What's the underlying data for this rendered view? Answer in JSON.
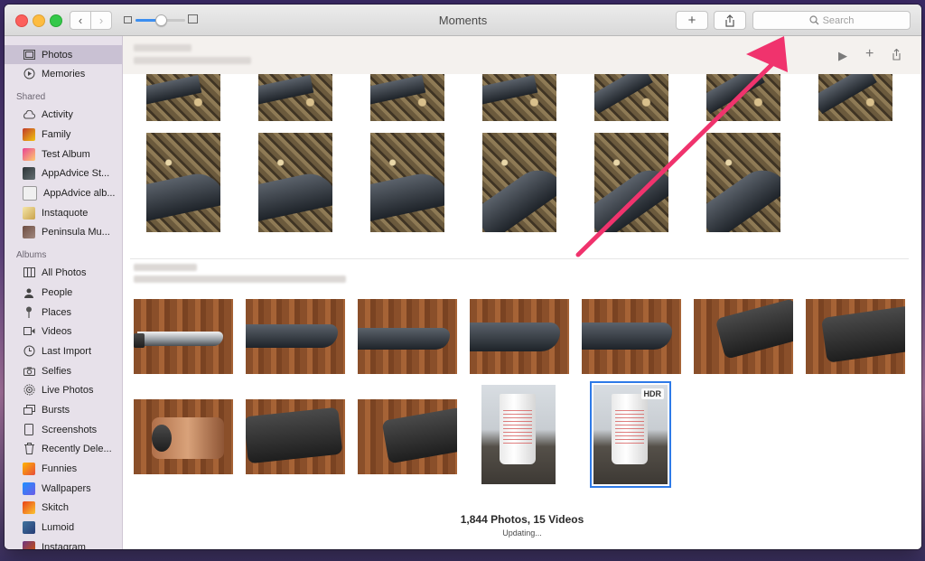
{
  "window": {
    "title": "Moments"
  },
  "search": {
    "placeholder": "Search"
  },
  "sidebar": {
    "top_items": [
      {
        "label": "Photos",
        "icon": "photos-icon"
      },
      {
        "label": "Memories",
        "icon": "memories-icon"
      }
    ],
    "shared_heading": "Shared",
    "shared_items": [
      {
        "label": "Activity",
        "icon": "activity-cloud-icon"
      },
      {
        "label": "Family",
        "icon": "shared-album-thumbnail"
      },
      {
        "label": "Test Album",
        "icon": "shared-album-thumbnail"
      },
      {
        "label": "AppAdvice St...",
        "icon": "shared-album-thumbnail"
      },
      {
        "label": "AppAdvice alb...",
        "icon": "shared-album-thumbnail"
      },
      {
        "label": "Instaquote",
        "icon": "shared-album-thumbnail"
      },
      {
        "label": "Peninsula Mu...",
        "icon": "shared-album-thumbnail"
      }
    ],
    "albums_heading": "Albums",
    "album_items": [
      {
        "label": "All Photos",
        "icon": "all-photos-icon"
      },
      {
        "label": "People",
        "icon": "people-icon"
      },
      {
        "label": "Places",
        "icon": "places-pin-icon"
      },
      {
        "label": "Videos",
        "icon": "videos-icon"
      },
      {
        "label": "Last Import",
        "icon": "last-import-icon"
      },
      {
        "label": "Selfies",
        "icon": "selfies-camera-icon"
      },
      {
        "label": "Live Photos",
        "icon": "live-photos-icon"
      },
      {
        "label": "Bursts",
        "icon": "bursts-icon"
      },
      {
        "label": "Screenshots",
        "icon": "screenshots-icon"
      },
      {
        "label": "Recently Dele...",
        "icon": "trash-icon"
      },
      {
        "label": "Funnies",
        "icon": "album-thumbnail"
      },
      {
        "label": "Wallpapers",
        "icon": "album-thumbnail"
      },
      {
        "label": "Skitch",
        "icon": "album-thumbnail"
      },
      {
        "label": "Lumoid",
        "icon": "album-thumbnail"
      },
      {
        "label": "Instagram",
        "icon": "album-thumbnail"
      }
    ]
  },
  "grid": {
    "hdr_badge": "HDR",
    "footer_count": "1,844 Photos, 15 Videos",
    "footer_status": "Updating..."
  },
  "colors": {
    "accent": "#2e7ae8",
    "sidebar_bg": "#e7e1ea",
    "selected_row": "#c9c1d3",
    "arrow": "#f0336d"
  }
}
